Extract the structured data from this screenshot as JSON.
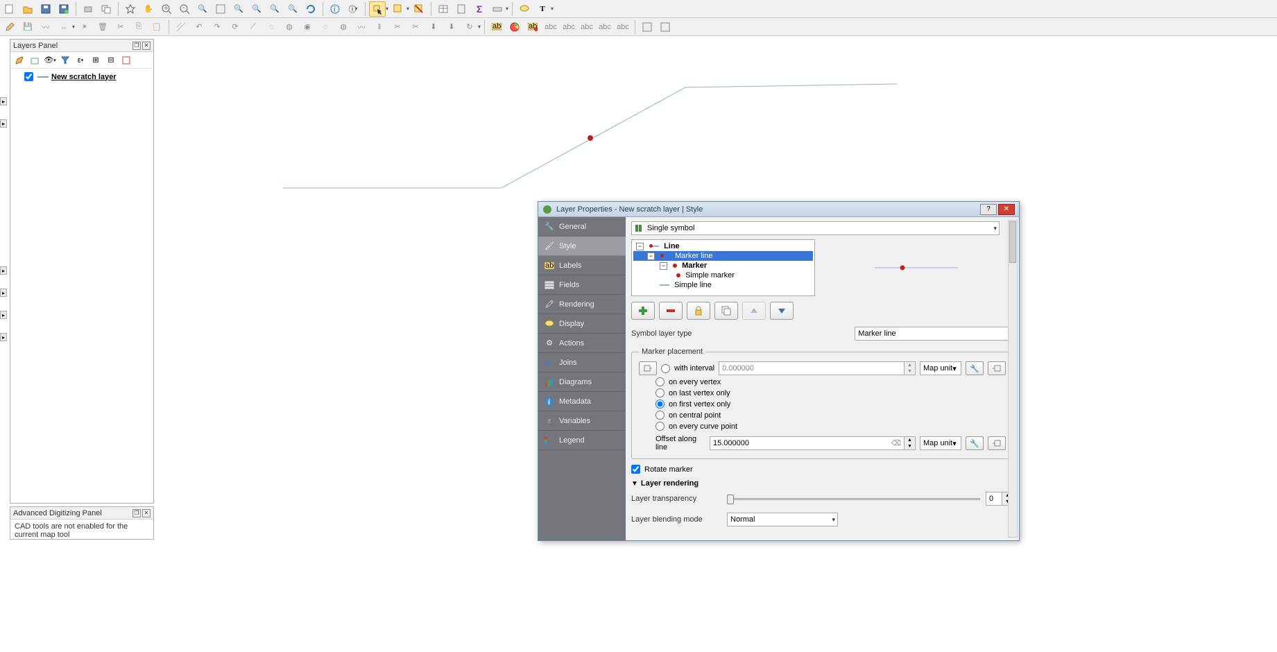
{
  "toolbars": {},
  "layers_panel": {
    "title": "Layers Panel",
    "layer_name": "New scratch layer"
  },
  "adv_panel": {
    "title": "Advanced Digitizing Panel",
    "msg": "CAD tools are not enabled for the current map tool"
  },
  "dialog": {
    "title": "Layer Properties - New scratch layer | Style",
    "nav": {
      "general": "General",
      "style": "Style",
      "labels": "Labels",
      "fields": "Fields",
      "rendering": "Rendering",
      "display": "Display",
      "actions": "Actions",
      "joins": "Joins",
      "diagrams": "Diagrams",
      "metadata": "Metadata",
      "variables": "Variables",
      "legend": "Legend"
    },
    "renderer": "Single symbol",
    "tree": {
      "line": "Line",
      "marker_line": "Marker line",
      "marker": "Marker",
      "simple_marker": "Simple marker",
      "simple_line": "Simple line"
    },
    "sym_type_label": "Symbol layer type",
    "sym_type_value": "Marker line",
    "placement": {
      "legend": "Marker placement",
      "with_interval": "with interval",
      "interval_val": "0.000000",
      "unit": "Map unit",
      "every_vertex": "on every vertex",
      "last_vertex": "on last vertex only",
      "first_vertex": "on first vertex only",
      "central": "on central point",
      "curve": "on every curve point",
      "offset_label": "Offset along line",
      "offset_val": "15.000000"
    },
    "rotate": "Rotate marker",
    "layer_rendering": "Layer rendering",
    "transparency_label": "Layer transparency",
    "transparency_val": "0",
    "blend_label": "Layer blending mode",
    "blend_val": "Normal"
  }
}
